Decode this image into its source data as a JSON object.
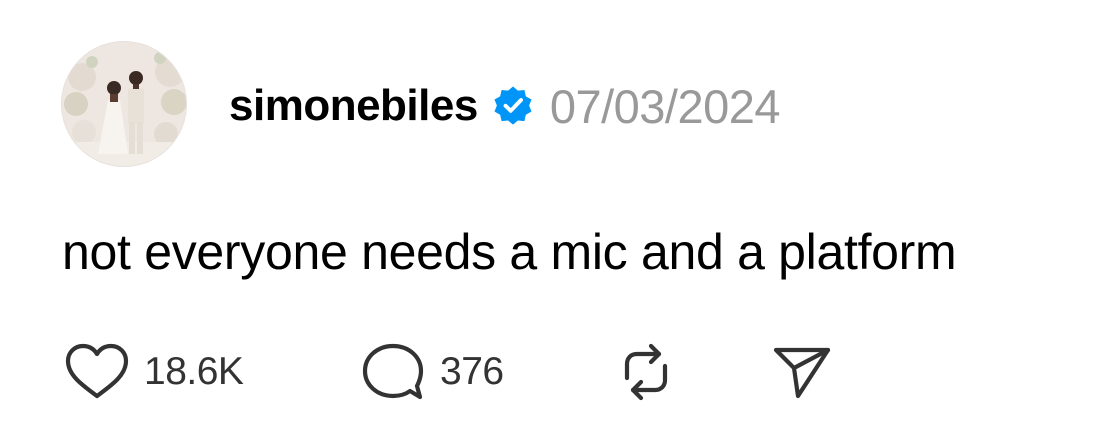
{
  "post": {
    "username": "simonebiles",
    "date": "07/03/2024",
    "text": "not everyone needs a mic and a platform",
    "verified": true
  },
  "actions": {
    "likes": "18.6K",
    "comments": "376"
  },
  "icons": {
    "verified": "verified-badge-icon",
    "like": "heart-icon",
    "comment": "speech-bubble-icon",
    "repost": "repost-icon",
    "share": "paper-plane-icon"
  },
  "colors": {
    "verified_badge": "#0095F6",
    "date_text": "#999999",
    "icon_stroke": "#333333"
  }
}
